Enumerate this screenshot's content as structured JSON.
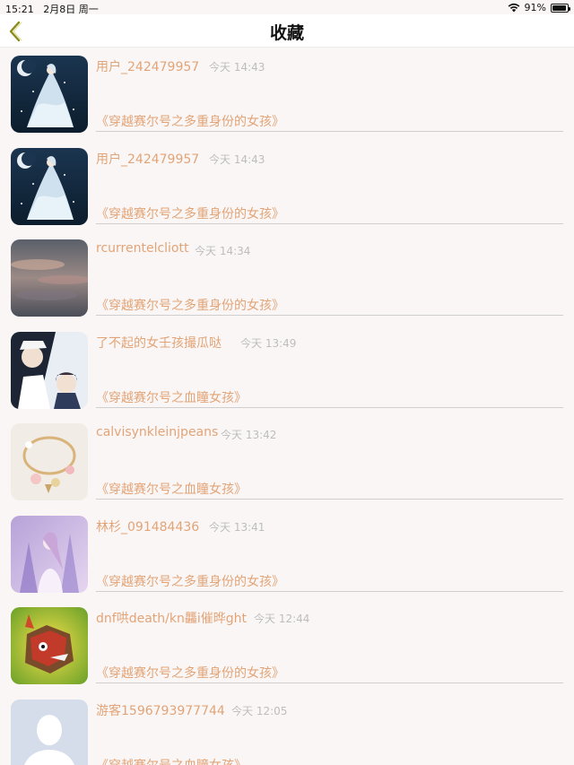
{
  "status_bar": {
    "time": "15:21",
    "date": "2月8日 周一",
    "battery": "91%",
    "battery_level": 0.91
  },
  "nav": {
    "title": "收藏",
    "back_icon": "chevron-left-icon",
    "accent_color": "#8a8a1e"
  },
  "colors": {
    "text_accent": "#e2a477",
    "time_text": "#bdbdbd",
    "background": "#faf6f6"
  },
  "items": [
    {
      "username": "用户_242479957",
      "time": "今天 14:43",
      "book": "《穿越赛尔号之多重身份的女孩》",
      "avatar": "anime-girl-white-dress"
    },
    {
      "username": "用户_242479957",
      "time": "今天 14:43",
      "book": "《穿越赛尔号之多重身份的女孩》",
      "avatar": "anime-girl-white-dress"
    },
    {
      "username": "rcurrentelcliott",
      "time": "今天 14:34",
      "book": "《穿越赛尔号之多重身份的女孩》",
      "avatar": "sky-clouds"
    },
    {
      "username": "了不起的女壬孩撮瓜哒",
      "time": "今天 13:49",
      "book": "《穿越赛尔号之血瞳女孩》",
      "avatar": "anime-detective-couple"
    },
    {
      "username": "calvisynkleinjpeans",
      "time": "今天 13:42",
      "book": "《穿越赛尔号之血瞳女孩》",
      "avatar": "jewelry-bracelet"
    },
    {
      "username": "林杉_091484436",
      "time": "今天 13:41",
      "book": "《穿越赛尔号之多重身份的女孩》",
      "avatar": "purple-fantasy-girl"
    },
    {
      "username": "dnf哄death/kn龘i催晔ght",
      "time": "今天 12:44",
      "book": "《穿越赛尔号之多重身份的女孩》",
      "avatar": "game-monster"
    },
    {
      "username": "游客1596793977744",
      "time": "今天 12:05",
      "book": "《穿越赛尔号之血瞳女孩》",
      "avatar": "default-person"
    }
  ]
}
